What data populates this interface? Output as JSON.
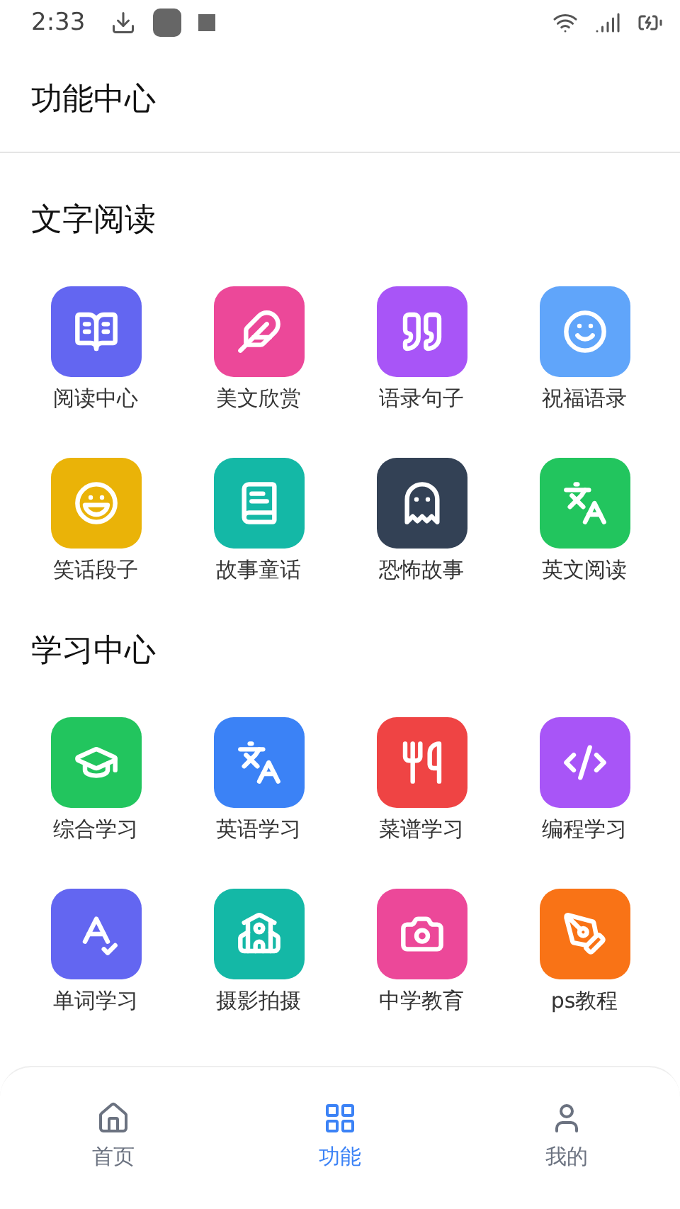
{
  "status_bar": {
    "time": "2:33"
  },
  "header": {
    "title": "功能中心"
  },
  "sections": [
    {
      "title": "文字阅读",
      "items": [
        {
          "label": "阅读中心",
          "color": "#6366f1"
        },
        {
          "label": "美文欣赏",
          "color": "#ec4899"
        },
        {
          "label": "语录句子",
          "color": "#a855f7"
        },
        {
          "label": "祝福语录",
          "color": "#60a5fa"
        },
        {
          "label": "笑话段子",
          "color": "#eab308"
        },
        {
          "label": "故事童话",
          "color": "#14b8a6"
        },
        {
          "label": "恐怖故事",
          "color": "#334155"
        },
        {
          "label": "英文阅读",
          "color": "#22c55e"
        }
      ]
    },
    {
      "title": "学习中心",
      "items": [
        {
          "label": "综合学习",
          "color": "#22c55e"
        },
        {
          "label": "英语学习",
          "color": "#3b82f6"
        },
        {
          "label": "菜谱学习",
          "color": "#ef4444"
        },
        {
          "label": "编程学习",
          "color": "#a855f7"
        },
        {
          "label": "单词学习",
          "color": "#6366f1"
        },
        {
          "label": "摄影拍摄",
          "color": "#14b8a6"
        },
        {
          "label": "中学教育",
          "color": "#ec4899"
        },
        {
          "label": "ps教程",
          "color": "#f97316"
        }
      ]
    }
  ],
  "nav": [
    {
      "label": "首页",
      "selected": false
    },
    {
      "label": "功能",
      "selected": true
    },
    {
      "label": "我的",
      "selected": false
    }
  ]
}
